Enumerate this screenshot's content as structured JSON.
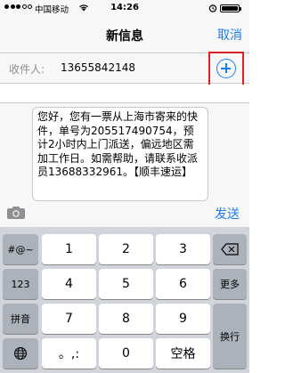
{
  "status_bar": {
    "carrier": "中国移动",
    "time": "14:26"
  },
  "nav": {
    "title": "新信息",
    "cancel_label": "取消"
  },
  "recipient": {
    "label": "收件人:",
    "value": "13655842148"
  },
  "compose": {
    "message": "您好，您有一票从上海市寄来的快件，单号为205517490754，预计2小时内上门派送，偏远地区需加工作日。如需帮助，请联系收派员13688332961。【顺丰速运】",
    "send_label": "发送"
  },
  "keyboard": {
    "rows": [
      {
        "left": "#@~",
        "keys": [
          "1",
          "2",
          "3"
        ],
        "right": "delete-icon"
      },
      {
        "left": "123",
        "keys": [
          "4",
          "5",
          "6"
        ],
        "right": "更多"
      },
      {
        "left": "拼音",
        "keys": [
          "7",
          "8",
          "9"
        ],
        "right": "换行"
      },
      {
        "left": "globe-icon",
        "keys": [
          "。,:",
          "0",
          "空格"
        ]
      }
    ]
  },
  "colors": {
    "accent": "#1a7ef2",
    "highlight": "#e02020"
  }
}
